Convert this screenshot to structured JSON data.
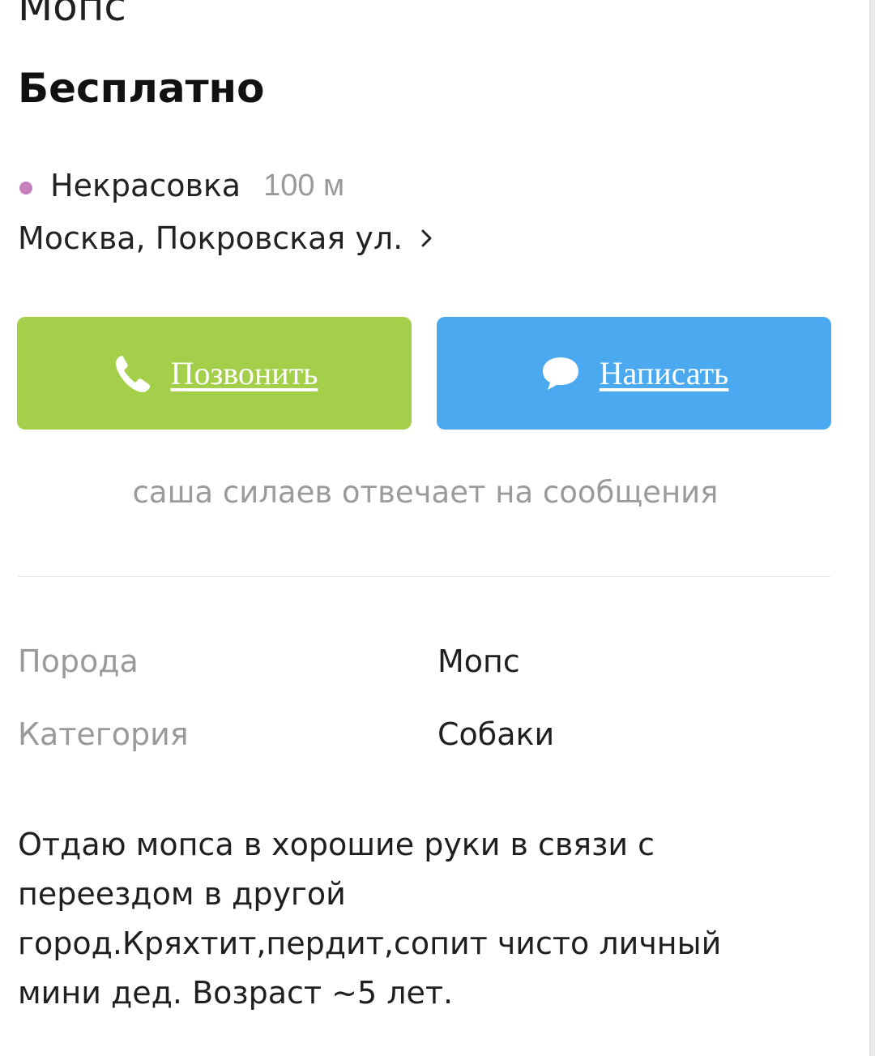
{
  "listing": {
    "title": "Мопс",
    "price": "Бесплатно"
  },
  "location": {
    "metro_station": "Некрасовка",
    "metro_distance": "100 м",
    "metro_color": "#c77fbd",
    "address": "Москва, Покровская ул."
  },
  "actions": {
    "call_label": "Позвонить",
    "call_color": "#a4cf4a",
    "call_icon": "phone-icon",
    "write_label": "Написать",
    "write_color": "#4aa9ef",
    "write_icon": "chat-bubble-icon",
    "link_color": "#ffffff"
  },
  "seller": {
    "response_note": "саша силаев отвечает на сообщения"
  },
  "params": [
    {
      "label": "Порода",
      "value": "Мопс"
    },
    {
      "label": "Категория",
      "value": "Собаки"
    }
  ],
  "description": {
    "lines": [
      "Отдаю мопса в хорошие руки в связи с",
      "переездом в другой",
      "город.Кряхтит,пердит,сопит чисто личный",
      "мини дед. Возраст ~5 лет."
    ]
  }
}
